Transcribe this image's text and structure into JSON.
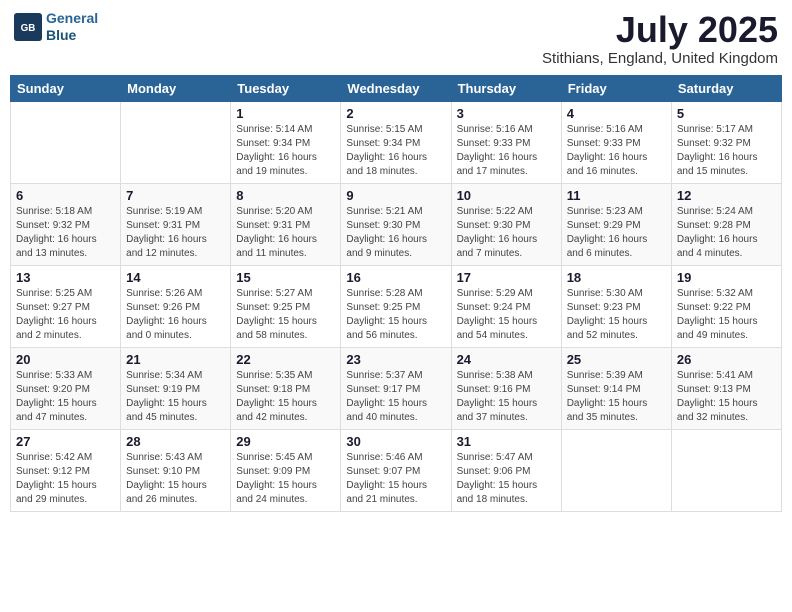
{
  "logo": {
    "line1": "General",
    "line2": "Blue"
  },
  "title": "July 2025",
  "location": "Stithians, England, United Kingdom",
  "days_of_week": [
    "Sunday",
    "Monday",
    "Tuesday",
    "Wednesday",
    "Thursday",
    "Friday",
    "Saturday"
  ],
  "weeks": [
    [
      {
        "day": "",
        "info": ""
      },
      {
        "day": "",
        "info": ""
      },
      {
        "day": "1",
        "info": "Sunrise: 5:14 AM\nSunset: 9:34 PM\nDaylight: 16 hours\nand 19 minutes."
      },
      {
        "day": "2",
        "info": "Sunrise: 5:15 AM\nSunset: 9:34 PM\nDaylight: 16 hours\nand 18 minutes."
      },
      {
        "day": "3",
        "info": "Sunrise: 5:16 AM\nSunset: 9:33 PM\nDaylight: 16 hours\nand 17 minutes."
      },
      {
        "day": "4",
        "info": "Sunrise: 5:16 AM\nSunset: 9:33 PM\nDaylight: 16 hours\nand 16 minutes."
      },
      {
        "day": "5",
        "info": "Sunrise: 5:17 AM\nSunset: 9:32 PM\nDaylight: 16 hours\nand 15 minutes."
      }
    ],
    [
      {
        "day": "6",
        "info": "Sunrise: 5:18 AM\nSunset: 9:32 PM\nDaylight: 16 hours\nand 13 minutes."
      },
      {
        "day": "7",
        "info": "Sunrise: 5:19 AM\nSunset: 9:31 PM\nDaylight: 16 hours\nand 12 minutes."
      },
      {
        "day": "8",
        "info": "Sunrise: 5:20 AM\nSunset: 9:31 PM\nDaylight: 16 hours\nand 11 minutes."
      },
      {
        "day": "9",
        "info": "Sunrise: 5:21 AM\nSunset: 9:30 PM\nDaylight: 16 hours\nand 9 minutes."
      },
      {
        "day": "10",
        "info": "Sunrise: 5:22 AM\nSunset: 9:30 PM\nDaylight: 16 hours\nand 7 minutes."
      },
      {
        "day": "11",
        "info": "Sunrise: 5:23 AM\nSunset: 9:29 PM\nDaylight: 16 hours\nand 6 minutes."
      },
      {
        "day": "12",
        "info": "Sunrise: 5:24 AM\nSunset: 9:28 PM\nDaylight: 16 hours\nand 4 minutes."
      }
    ],
    [
      {
        "day": "13",
        "info": "Sunrise: 5:25 AM\nSunset: 9:27 PM\nDaylight: 16 hours\nand 2 minutes."
      },
      {
        "day": "14",
        "info": "Sunrise: 5:26 AM\nSunset: 9:26 PM\nDaylight: 16 hours\nand 0 minutes."
      },
      {
        "day": "15",
        "info": "Sunrise: 5:27 AM\nSunset: 9:25 PM\nDaylight: 15 hours\nand 58 minutes."
      },
      {
        "day": "16",
        "info": "Sunrise: 5:28 AM\nSunset: 9:25 PM\nDaylight: 15 hours\nand 56 minutes."
      },
      {
        "day": "17",
        "info": "Sunrise: 5:29 AM\nSunset: 9:24 PM\nDaylight: 15 hours\nand 54 minutes."
      },
      {
        "day": "18",
        "info": "Sunrise: 5:30 AM\nSunset: 9:23 PM\nDaylight: 15 hours\nand 52 minutes."
      },
      {
        "day": "19",
        "info": "Sunrise: 5:32 AM\nSunset: 9:22 PM\nDaylight: 15 hours\nand 49 minutes."
      }
    ],
    [
      {
        "day": "20",
        "info": "Sunrise: 5:33 AM\nSunset: 9:20 PM\nDaylight: 15 hours\nand 47 minutes."
      },
      {
        "day": "21",
        "info": "Sunrise: 5:34 AM\nSunset: 9:19 PM\nDaylight: 15 hours\nand 45 minutes."
      },
      {
        "day": "22",
        "info": "Sunrise: 5:35 AM\nSunset: 9:18 PM\nDaylight: 15 hours\nand 42 minutes."
      },
      {
        "day": "23",
        "info": "Sunrise: 5:37 AM\nSunset: 9:17 PM\nDaylight: 15 hours\nand 40 minutes."
      },
      {
        "day": "24",
        "info": "Sunrise: 5:38 AM\nSunset: 9:16 PM\nDaylight: 15 hours\nand 37 minutes."
      },
      {
        "day": "25",
        "info": "Sunrise: 5:39 AM\nSunset: 9:14 PM\nDaylight: 15 hours\nand 35 minutes."
      },
      {
        "day": "26",
        "info": "Sunrise: 5:41 AM\nSunset: 9:13 PM\nDaylight: 15 hours\nand 32 minutes."
      }
    ],
    [
      {
        "day": "27",
        "info": "Sunrise: 5:42 AM\nSunset: 9:12 PM\nDaylight: 15 hours\nand 29 minutes."
      },
      {
        "day": "28",
        "info": "Sunrise: 5:43 AM\nSunset: 9:10 PM\nDaylight: 15 hours\nand 26 minutes."
      },
      {
        "day": "29",
        "info": "Sunrise: 5:45 AM\nSunset: 9:09 PM\nDaylight: 15 hours\nand 24 minutes."
      },
      {
        "day": "30",
        "info": "Sunrise: 5:46 AM\nSunset: 9:07 PM\nDaylight: 15 hours\nand 21 minutes."
      },
      {
        "day": "31",
        "info": "Sunrise: 5:47 AM\nSunset: 9:06 PM\nDaylight: 15 hours\nand 18 minutes."
      },
      {
        "day": "",
        "info": ""
      },
      {
        "day": "",
        "info": ""
      }
    ]
  ]
}
